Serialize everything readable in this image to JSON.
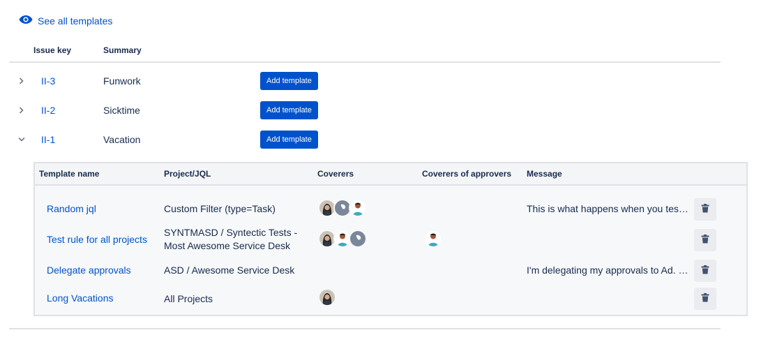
{
  "see_all": {
    "label": "See all templates",
    "icon": "eye-icon",
    "color": "#0052cc"
  },
  "issue_table": {
    "headers": {
      "key": "Issue key",
      "summary": "Summary"
    },
    "rows": [
      {
        "key": "II-3",
        "summary": "Funwork",
        "button": "Add template",
        "expanded": false
      },
      {
        "key": "II-2",
        "summary": "Sicktime",
        "button": "Add template",
        "expanded": false
      },
      {
        "key": "II-1",
        "summary": "Vacation",
        "button": "Add template",
        "expanded": true
      }
    ]
  },
  "templates": {
    "headers": {
      "name": "Template name",
      "project": "Project/JQL",
      "coverers": "Coverers",
      "approvers": "Coverers of approvers",
      "message": "Message"
    },
    "rows": [
      {
        "name": "Random jql",
        "project": "Custom Filter (type=Task)",
        "coverers": [
          "woman-avatar",
          "placeholder-avatar",
          "man-avatar"
        ],
        "approvers": [],
        "message": "This is what happens when you tes…"
      },
      {
        "name": "Test rule for all projects",
        "project_line1": "SYNTMASD / Syntectic Tests -",
        "project_line2": "Most Awesome Service Desk",
        "coverers": [
          "woman-avatar",
          "man-avatar",
          "placeholder-avatar"
        ],
        "approvers": [
          "man-avatar"
        ],
        "message": ""
      },
      {
        "name": "Delegate approvals",
        "project": "ASD / Awesome Service Desk",
        "coverers": [],
        "approvers": [],
        "message": "I'm delegating my approvals to Ad. …"
      },
      {
        "name": "Long Vacations",
        "project": "All Projects",
        "coverers": [
          "woman-avatar"
        ],
        "approvers": [],
        "message": ""
      }
    ]
  },
  "colors": {
    "link": "#0052cc",
    "button_bg": "#0052cc",
    "border": "#dfe1e6",
    "panel_bg": "#f7f8f9"
  }
}
